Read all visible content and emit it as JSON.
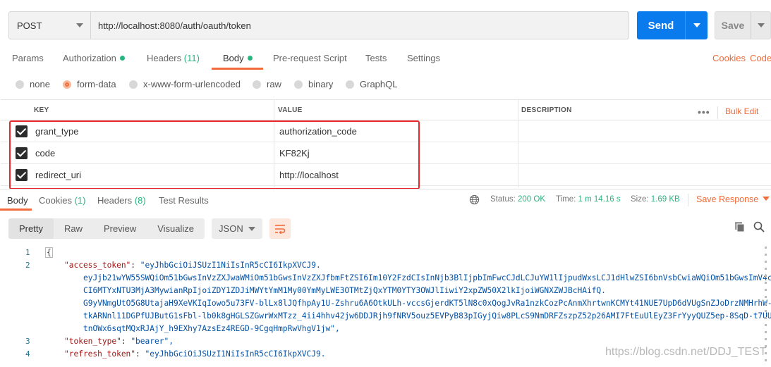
{
  "request": {
    "method": "POST",
    "url": "http://localhost:8080/auth/oauth/token",
    "send_label": "Send",
    "save_label": "Save"
  },
  "tabs": {
    "params": "Params",
    "authorization": "Authorization",
    "headers": "Headers",
    "headers_count": "(11)",
    "body": "Body",
    "prerequest": "Pre-request Script",
    "tests": "Tests",
    "settings": "Settings",
    "cookies": "Cookies",
    "code": "Code"
  },
  "body_types": [
    "none",
    "form-data",
    "x-www-form-urlencoded",
    "raw",
    "binary",
    "GraphQL"
  ],
  "body_type_selected": "form-data",
  "table": {
    "key_header": "KEY",
    "value_header": "VALUE",
    "description_header": "DESCRIPTION",
    "more": "•••",
    "bulk_edit": "Bulk Edit",
    "rows": [
      {
        "key": "grant_type",
        "value": "authorization_code",
        "checked": true
      },
      {
        "key": "code",
        "value": "KF82Kj",
        "checked": true
      },
      {
        "key": "redirect_uri",
        "value": "http://localhost",
        "checked": true
      }
    ]
  },
  "response": {
    "tab_body": "Body",
    "tab_cookies": "Cookies",
    "cookies_count": "(1)",
    "tab_headers": "Headers",
    "headers_count": "(8)",
    "tab_tests": "Test Results",
    "status_label": "Status:",
    "status_value": "200 OK",
    "time_label": "Time:",
    "time_value": "1 m 14.16 s",
    "size_label": "Size:",
    "size_value": "1.69 KB",
    "save_response": "Save Response",
    "views": [
      "Pretty",
      "Raw",
      "Preview",
      "Visualize"
    ],
    "active_view": "Pretty",
    "format": "JSON"
  },
  "code_lines": {
    "l1_num": "1",
    "l1": "{",
    "l2_num": "2",
    "l2_key": "\"access_token\"",
    "l2_val": "\"eyJhbGciOiJSUzI1NiIsInR5cCI6IkpXVCJ9.",
    "l2_c1": "eyJjb21wYW55SWQiOm51bGwsInVzZXJwaWMiOm51bGwsInVzZXJfbmFtZSI6Im10Y2FzdCIsInNjb3BlIjpbImFwcCJdLCJuYW1lIjpudWxsLCJ1dHlwZSI6bnVsbCwiaWQiOm51bGwsImV4c",
    "l2_c2": "CI6MTYxNTU3MjA3MywianRpIjoiZDY1ZDJiMWYtYmM1My00YmMyLWE3OTMtZjQxYTM0YTY3OWJlIiwiY2xpZW50X2lkIjoiWGNXZWJBcHAifQ.",
    "l2_c3": "G9yVNmgUtO5G8UtajaH9XeVKIqIowo5u73FV-blLx8lJQfhpAy1U-Zshru6A6OtkULh-vccsGjerdKT5lN8c0xQogJvRa1nzkCozPcAnmXhrtwnKCMYt41NUE7UpD6dVUgSnZJoDrzNMHrhW-",
    "l2_c4": "tkARNnl11DGPfUJButG1sFbl-lb0k8gHGLSZGwrWxMTzz_4ii4hhv42jw6DDJRjh9fNRV5ouz5EVPyB83pIGyjQiw8PLcS9NmDRFZszpZ52p26AMI7FtEuUlEyZ3FrYyyQUZ5ep-8SqD-t7UU",
    "l2_c5": "tnOWx6sqtMQxRJAjY_h9EXhy7AzsEz4REGD-9CgqHmpRwVhgV1jw\",",
    "l3_num": "3",
    "l3_key": "\"token_type\"",
    "l3_val": "\"bearer\",",
    "l4_num": "4",
    "l4_key": "\"refresh_token\"",
    "l4_val": "\"eyJhbGciOiJSUzI1NiIsInR5cCI6IkpXVCJ9."
  },
  "watermark": "https://blog.csdn.net/DDJ_TEST"
}
